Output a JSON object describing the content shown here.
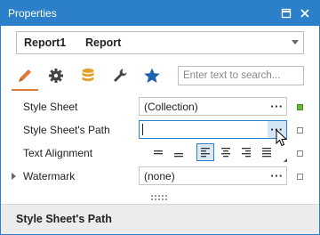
{
  "window": {
    "title": "Properties"
  },
  "selector": {
    "name": "Report1",
    "type": "Report"
  },
  "tabs": [
    {
      "icon": "pencil-icon",
      "selected": true
    },
    {
      "icon": "gear-icon"
    },
    {
      "icon": "database-icon"
    },
    {
      "icon": "wrench-icon"
    },
    {
      "icon": "star-icon"
    }
  ],
  "search": {
    "placeholder": "Enter text to search..."
  },
  "properties": [
    {
      "label": "Style Sheet",
      "value": "(Collection)"
    },
    {
      "label": "Style Sheet's Path",
      "value": ""
    },
    {
      "label": "Text Alignment"
    },
    {
      "label": "Watermark",
      "value": "(none)"
    }
  ],
  "editor_button": {
    "label": "···"
  },
  "description": {
    "title": "Style Sheet's Path"
  },
  "colors": {
    "accent": "#2b80c9",
    "tab_underline": "#e07a3b",
    "modified_marker": "#6db33f"
  }
}
